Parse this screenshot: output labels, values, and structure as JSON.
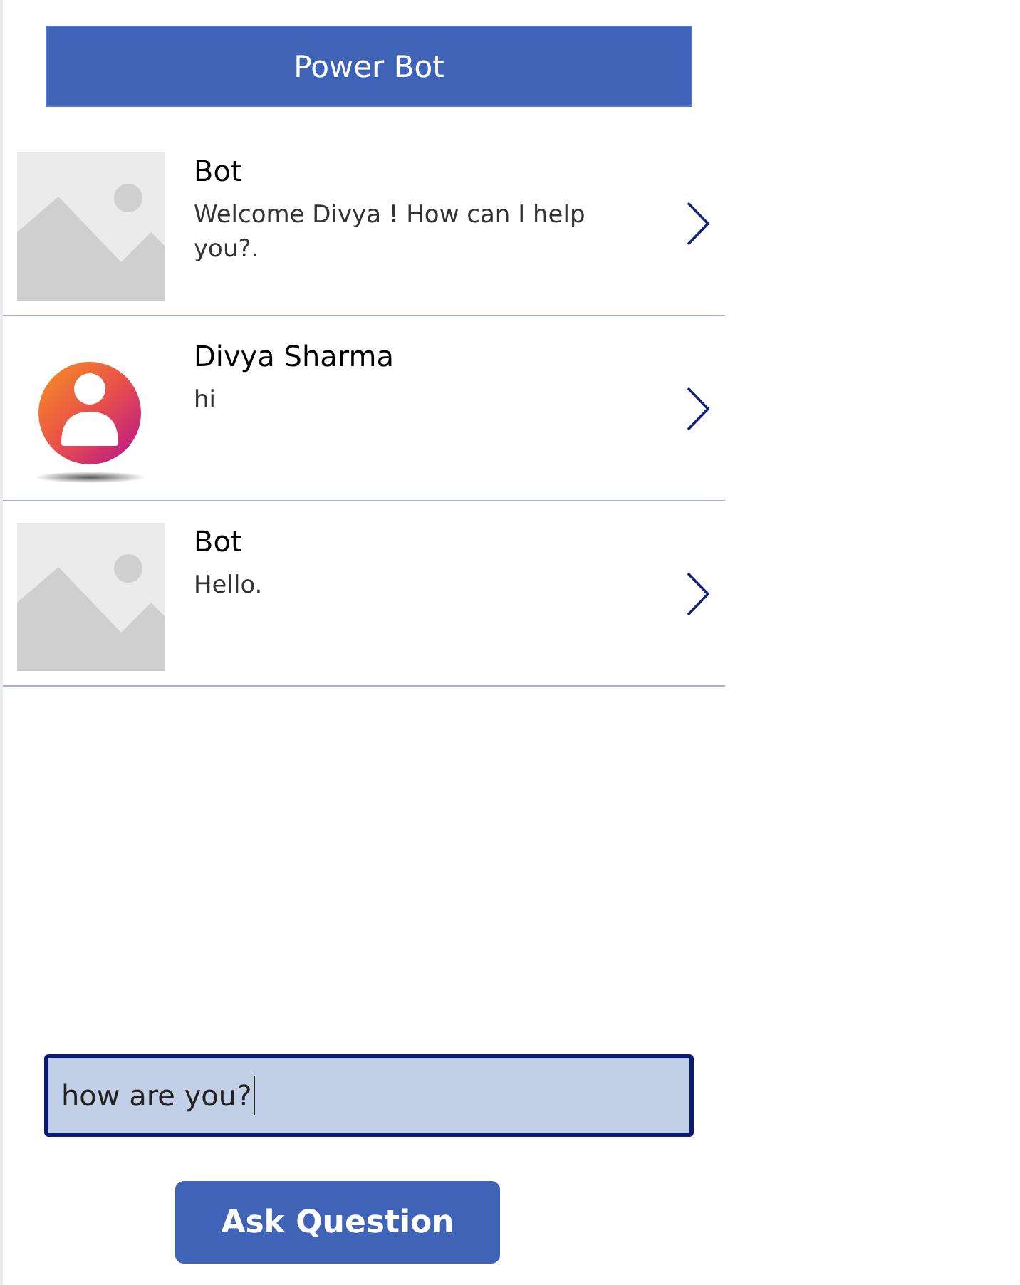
{
  "header": {
    "title": "Power Bot"
  },
  "messages": [
    {
      "kind": "image",
      "sender": "Bot",
      "text": "Welcome Divya ! How can I help you?."
    },
    {
      "kind": "person",
      "sender": "Divya Sharma",
      "text": "hi"
    },
    {
      "kind": "image",
      "sender": "Bot",
      "text": "Hello."
    }
  ],
  "input": {
    "value": "how are you?",
    "focused": true
  },
  "button": {
    "label": "Ask Question"
  }
}
